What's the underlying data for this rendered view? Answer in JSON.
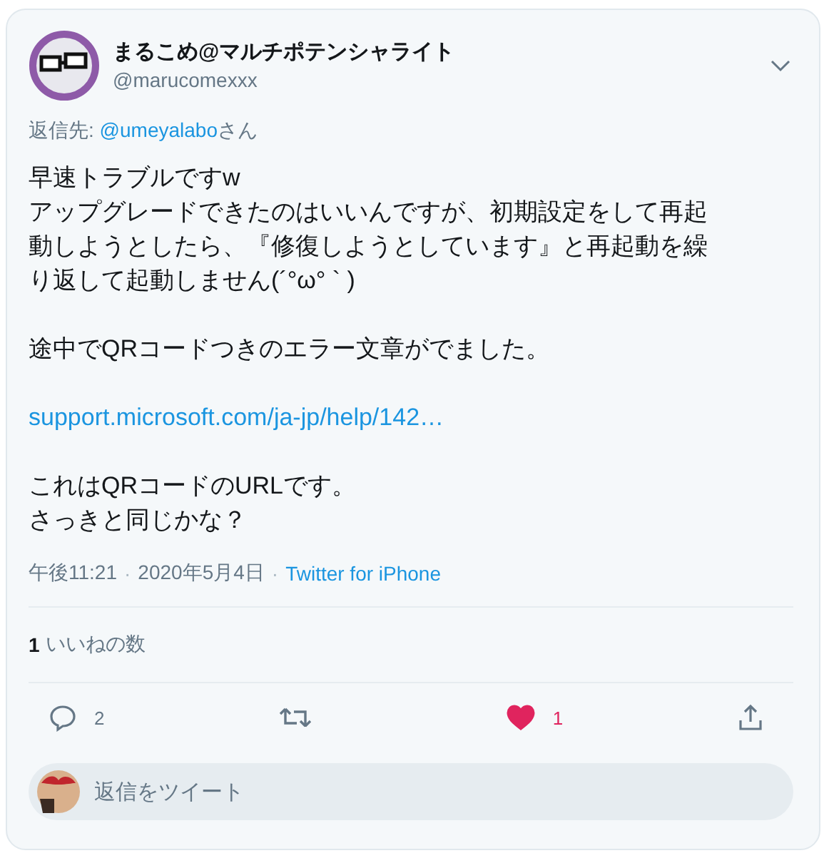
{
  "author": {
    "name": "まるこめ@マルチポテンシャライト",
    "handle": "@marucomexxx"
  },
  "reply_to": {
    "label": "返信先:",
    "handle": "@umeyalabo",
    "suffix": "さん"
  },
  "body": [
    {
      "kind": "text",
      "lines": [
        "早速トラブルですw",
        "アップグレードできたのはいいんですが、初期設定をして再起",
        "動しようとしたら、『修復しようとしています』と再起動を繰",
        "り返して起動しません(´°ω° ` )"
      ]
    },
    {
      "kind": "text",
      "lines": [
        "途中でQRコードつきのエラー文章がでました。"
      ]
    },
    {
      "kind": "link",
      "lines": [
        "support.microsoft.com/ja-jp/help/142…"
      ]
    },
    {
      "kind": "text",
      "lines": [
        "これはQRコードのURLです。",
        "さっきと同じかな？"
      ]
    }
  ],
  "meta": {
    "time": "午後11:21",
    "separator": "·",
    "date": "2020年5月4日",
    "source": "Twitter for iPhone"
  },
  "likes": {
    "count": "1",
    "label": "いいねの数"
  },
  "actions": [
    {
      "kind": "reply",
      "count": "2",
      "selected": false
    },
    {
      "kind": "retweet",
      "selected": false
    },
    {
      "kind": "like",
      "count": "1",
      "selected": true
    },
    {
      "kind": "share",
      "selected": false
    }
  ],
  "reply_box": {
    "placeholder": "返信をツイート"
  }
}
